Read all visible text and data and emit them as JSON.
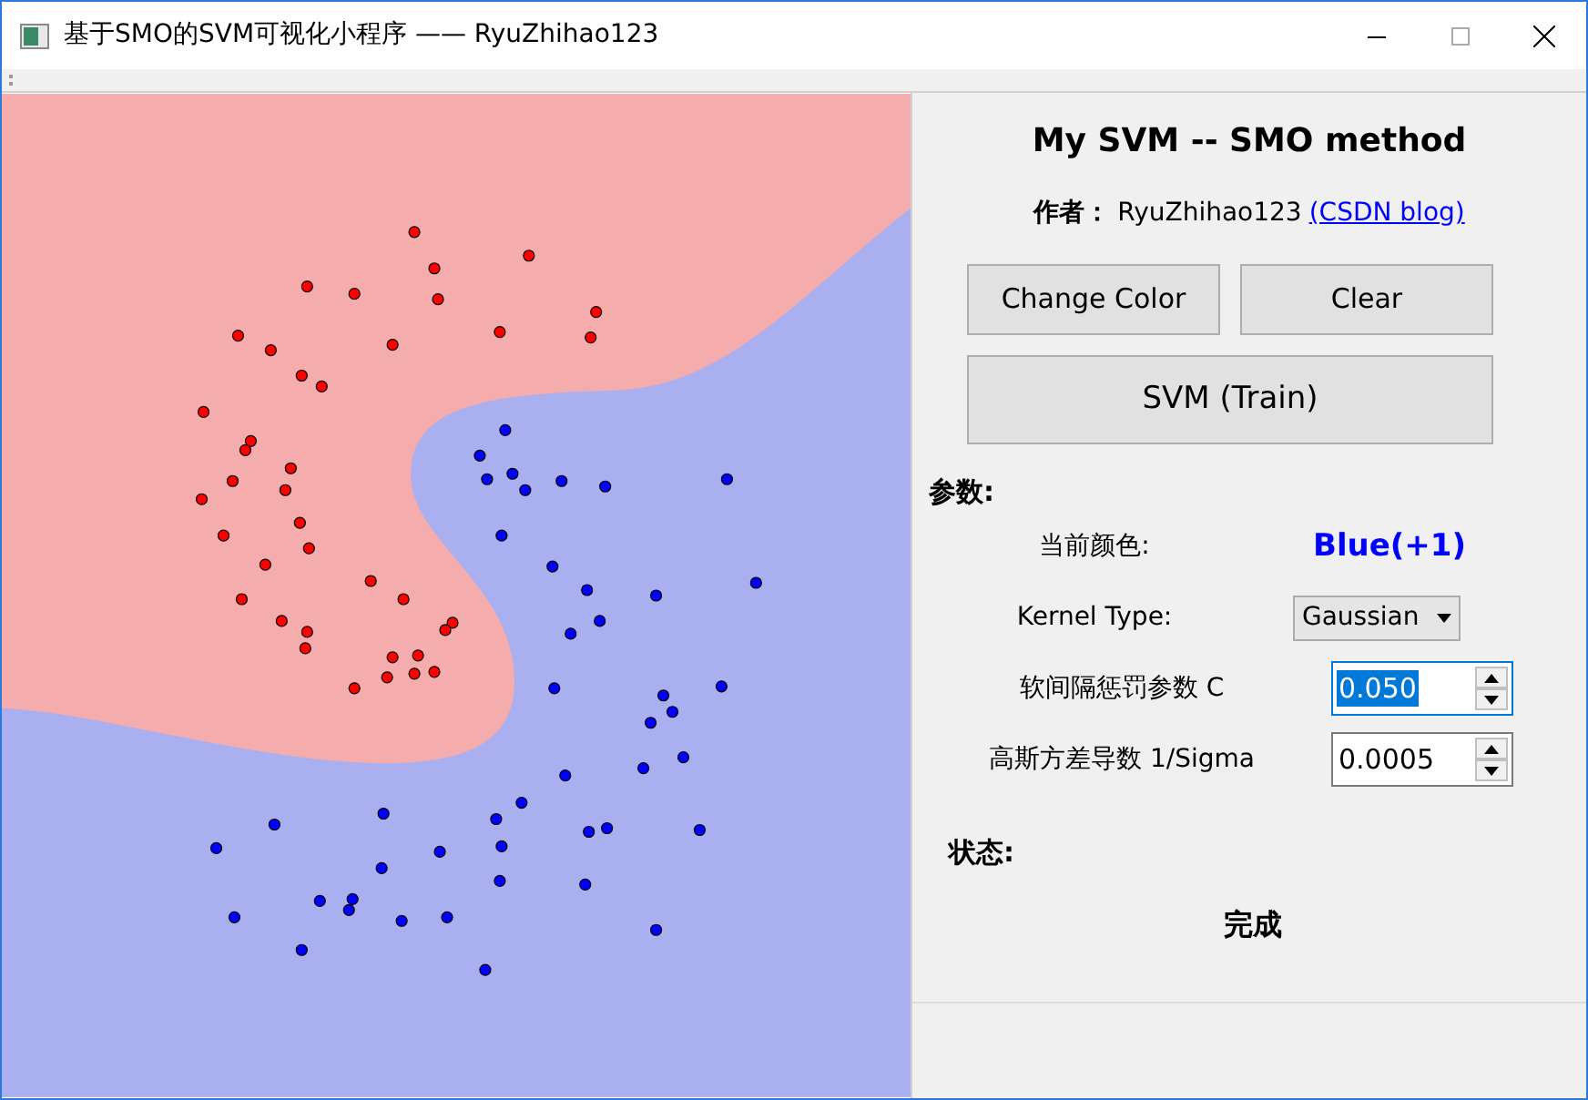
{
  "window": {
    "title": "基于SMO的SVM可视化小程序 —— RyuZhihao123"
  },
  "panel": {
    "heading": "My SVM -- SMO method",
    "author_label": "作者：",
    "author_name": "RyuZhihao123",
    "author_link": "(CSDN blog)",
    "buttons": [
      "Change Color",
      "Clear"
    ],
    "train_button": "SVM (Train)",
    "params_heading": "参数:",
    "current_color": {
      "label": "当前颜色:",
      "value": "Blue(+1)"
    },
    "kernel": {
      "label": "Kernel Type:",
      "value": "Gaussian"
    },
    "spinboxes": [
      {
        "label": "软间隔惩罚参数 C",
        "value": "0.050",
        "focused": true
      },
      {
        "label": "高斯方差导数 1/Sigma",
        "value": "0.0005",
        "focused": false
      }
    ],
    "status_heading": "状态:",
    "status": "完成"
  }
}
